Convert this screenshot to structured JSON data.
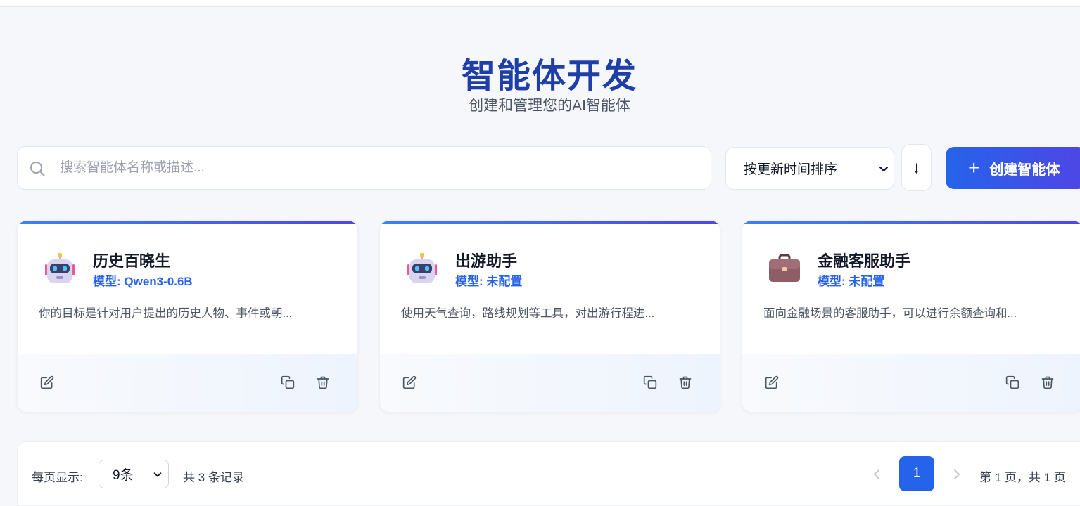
{
  "header": {
    "title": "智能体开发",
    "subtitle": "创建和管理您的AI智能体"
  },
  "toolbar": {
    "search_placeholder": "搜索智能体名称或描述...",
    "sort_selected": "按更新时间排序",
    "sort_direction": "↓",
    "create_label": "创建智能体"
  },
  "agents": [
    {
      "name": "历史百晓生",
      "model": "模型: Qwen3-0.6B",
      "description": "你的目标是针对用户提出的历史人物、事件或朝...",
      "icon": "robot-icon"
    },
    {
      "name": "出游助手",
      "model": "模型: 未配置",
      "description": "使用天气查询，路线规划等工具，对出游行程进...",
      "icon": "robot-icon"
    },
    {
      "name": "金融客服助手",
      "model": "模型: 未配置",
      "description": "面向金融场景的客服助手，可以进行余额查询和...",
      "icon": "briefcase-icon"
    }
  ],
  "pagination": {
    "per_page_label": "每页显示:",
    "per_page_selected": "9条",
    "total_label": "共 3 条记录",
    "current_page": "1",
    "page_info": "第 1 页，共 1 页"
  },
  "colors": {
    "accent": "#2563eb",
    "title": "#1e3fa8",
    "gradient_end": "#4f46e5"
  }
}
